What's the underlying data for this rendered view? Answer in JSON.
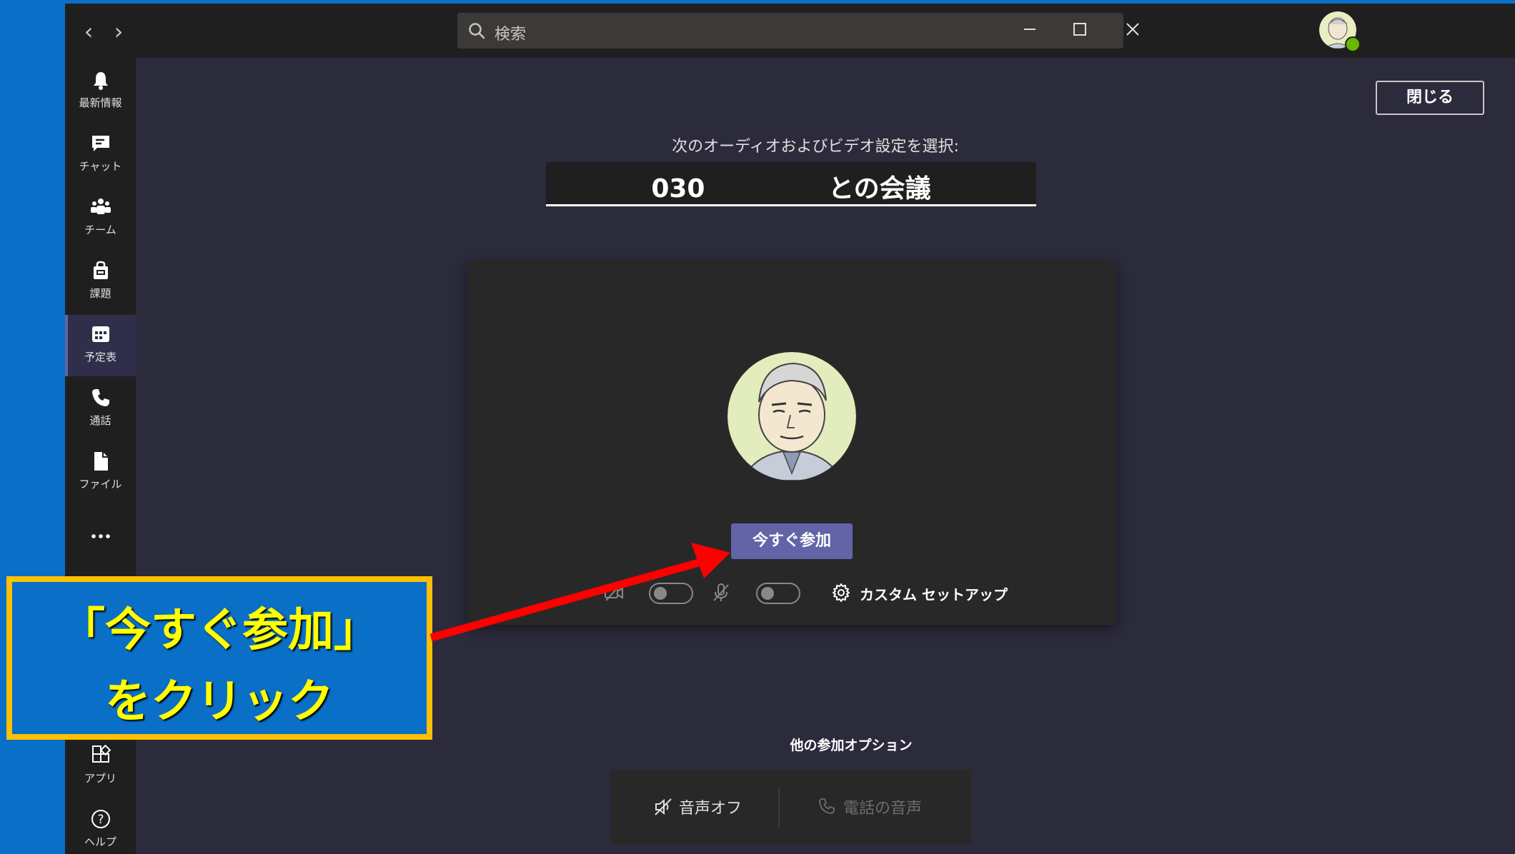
{
  "titlebar": {
    "back_icon": "chevron-left-icon",
    "forward_icon": "chevron-right-icon",
    "search_placeholder": "検索",
    "window_controls": [
      "minimize-icon",
      "maximize-icon",
      "close-icon"
    ]
  },
  "sidebar": {
    "items": [
      {
        "label": "最新情報",
        "icon": "bell-icon"
      },
      {
        "label": "チャット",
        "icon": "chat-icon"
      },
      {
        "label": "チーム",
        "icon": "teams-icon"
      },
      {
        "label": "課題",
        "icon": "assignments-icon"
      },
      {
        "label": "予定表",
        "icon": "calendar-icon",
        "active": true
      },
      {
        "label": "通話",
        "icon": "phone-icon"
      },
      {
        "label": "ファイル",
        "icon": "files-icon"
      },
      {
        "label": "…",
        "icon": "more-icon"
      }
    ],
    "bottom_items": [
      {
        "label": "アプリ",
        "icon": "apps-icon"
      },
      {
        "label": "ヘルプ",
        "icon": "help-icon"
      }
    ]
  },
  "prejoin": {
    "close_label": "閉じる",
    "subtitle": "次のオーディオおよびビデオ設定を選択:",
    "meeting_title": "030 との会議",
    "join_label": "今すぐ参加",
    "camera_enabled": false,
    "mic_enabled": false,
    "custom_setup_label": "カスタム セットアップ"
  },
  "other_options": {
    "title": "他の参加オプション",
    "audio_off_label": "音声オフ",
    "phone_audio_label": "電話の音声"
  },
  "annotation": {
    "line1": "「今すぐ参加」",
    "line2": "をクリック"
  },
  "colors": {
    "accent": "#6264a7",
    "annotation_bg": "#0a6fc7",
    "annotation_border": "#ffc000",
    "annotation_text": "#ffff00",
    "arrow": "#ff0000",
    "presence": "#6bb700"
  }
}
